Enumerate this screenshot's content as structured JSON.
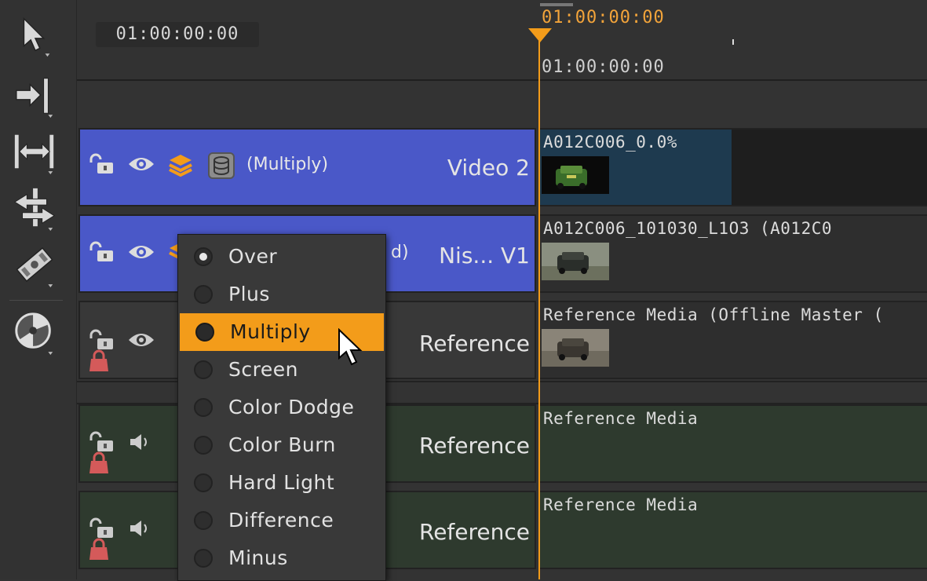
{
  "timecode": {
    "current": "01:00:00:00"
  },
  "ruler": {
    "playhead_label": "01:00:00:00",
    "start_label": "01:00:00:00"
  },
  "tracks": [
    {
      "name": "Video 2",
      "blend_label": "(Multiply)",
      "clip_label": "A012C006_0.0%"
    },
    {
      "name": "Nis... V1",
      "blend_label_partial": "d)",
      "clip_label": "A012C006_101030_L1O3 (A012C0"
    },
    {
      "name": "Reference",
      "clip_label": "Reference Media (Offline Master ("
    },
    {
      "name": "Reference",
      "clip_label": "Reference Media"
    },
    {
      "name": "Reference",
      "clip_label": "Reference Media"
    }
  ],
  "blend_menu": {
    "items": [
      "Over",
      "Plus",
      "Multiply",
      "Screen",
      "Color Dodge",
      "Color Burn",
      "Hard Light",
      "Difference",
      "Minus"
    ],
    "selected": "Over",
    "highlighted": "Multiply"
  },
  "colors": {
    "accent": "#f39c1a",
    "video_track": "#4a58c8",
    "audio_track": "#2e3a2e",
    "clip_video2": "#1e3a4f"
  },
  "icons": [
    "pointer-tool-icon",
    "ripple-edit-icon",
    "slip-tool-icon",
    "slide-tool-icon",
    "razor-tool-icon",
    "multi-view-icon",
    "lock-icon",
    "eye-icon",
    "layers-icon",
    "blend-icon",
    "speaker-icon",
    "mask-icon"
  ]
}
